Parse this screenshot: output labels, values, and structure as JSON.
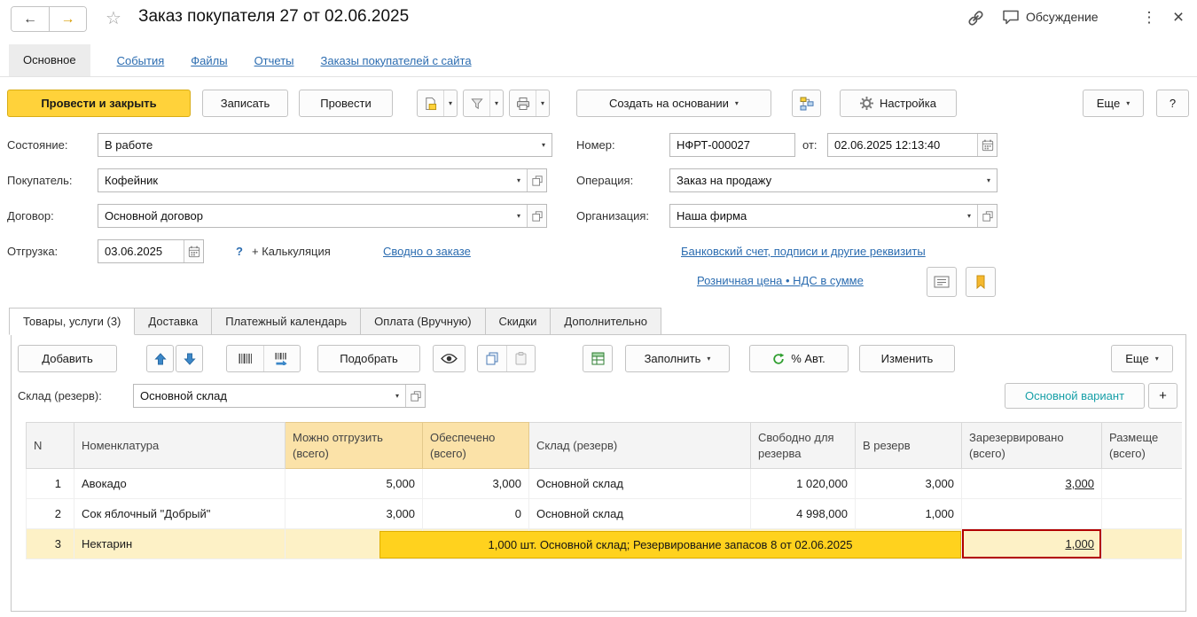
{
  "colors": {
    "accent_yellow": "#ffd23a",
    "link_blue": "#2b6cb0",
    "positive_green": "#1d8f1d",
    "warning_orange": "#dd9300",
    "negative_red": "#cc1111",
    "variant_teal": "#18a0a8",
    "tooltip_yellow": "#ffd21e",
    "highlighted_header": "#fbe2a8",
    "selected_row": "#fdf1c6",
    "red_outline": "#b30000"
  },
  "icons": {
    "back": "←",
    "forward": "→",
    "star": "☆",
    "kebab": "⋮",
    "close": "×",
    "caret_down": "▾"
  },
  "titlebar": {
    "title": "Заказ покупателя 27 от 02.06.2025",
    "discussion": "Обсуждение"
  },
  "nav_tabs": {
    "main": "Основное",
    "events": "События",
    "files": "Файлы",
    "reports": "Отчеты",
    "site_orders": "Заказы покупателей с сайта"
  },
  "toolbar": {
    "post_and_close": "Провести и закрыть",
    "write": "Записать",
    "post": "Провести",
    "create_based_on": "Создать на основании",
    "settings": "Настройка",
    "more": "Еще",
    "help": "?"
  },
  "form": {
    "state_label": "Состояние:",
    "state_value": "В работе",
    "customer_label": "Покупатель:",
    "customer_value": "Кофейник",
    "contract_label": "Договор:",
    "contract_value": "Основной договор",
    "shipping_label": "Отгрузка:",
    "shipping_date": "03.06.2025",
    "shipping_help": "?",
    "calculation_link": "+ Калькуляция",
    "order_summary_link": "Сводно о заказе",
    "number_label": "Номер:",
    "number_value": "НФРТ-000027",
    "from_label": "от:",
    "datetime_value": "02.06.2025 12:13:40",
    "operation_label": "Операция:",
    "operation_value": "Заказ на продажу",
    "org_label": "Организация:",
    "org_value": "Наша фирма",
    "bank_link": "Банковский счет, подписи и другие реквизиты",
    "price_link": "Розничная цена • НДС в сумме"
  },
  "doc_tabs": {
    "goods": "Товары, услуги (3)",
    "delivery": "Доставка",
    "payment_calendar": "Платежный календарь",
    "payment": "Оплата (Вручную)",
    "discounts": "Скидки",
    "additional": "Дополнительно"
  },
  "grid_toolbar": {
    "add": "Добавить",
    "pick": "Подобрать",
    "fill": "Заполнить",
    "auto_percent": "% Авт.",
    "edit": "Изменить",
    "more": "Еще"
  },
  "warehouse": {
    "label": "Склад (резерв):",
    "value": "Основной склад",
    "variant_button": "Основной вариант",
    "add_variant_button": "+"
  },
  "grid": {
    "columns": [
      "N",
      "Номенклатура",
      "Можно отгрузить (всего)",
      "Обеспечено (всего)",
      "Склад (резерв)",
      "Свободно для резерва",
      "В резерв",
      "Зарезервировано (всего)",
      "Размеще (всего)"
    ],
    "rows": [
      [
        "1",
        "Авокадо",
        "5,000",
        "3,000",
        "Основной склад",
        "1 020,000",
        "3,000",
        "3,000",
        ""
      ],
      [
        "2",
        "Сок яблочный \"Добрый\"",
        "3,000",
        "0",
        "Основной склад",
        "4 998,000",
        "1,000",
        "",
        ""
      ],
      [
        "3",
        "Нектарин",
        "",
        "",
        "",
        "",
        "",
        "1,000",
        ""
      ]
    ],
    "reservation_tooltip": "1,000 шт. Основной склад; Резервирование запасов 8 от 02.06.2025"
  }
}
